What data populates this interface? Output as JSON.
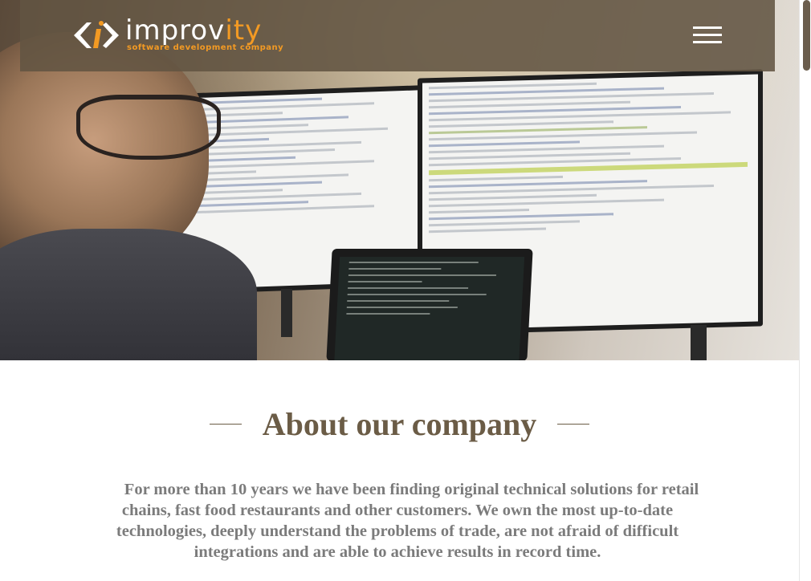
{
  "header": {
    "logo": {
      "name_main": "improv",
      "name_accent": "ity",
      "tagline": "software development company"
    },
    "menu_icon": "hamburger-menu-icon"
  },
  "hero": {
    "image": "developer-at-monitors-photo"
  },
  "about": {
    "title": "About our company",
    "text": "For more than 10 years we have been finding original technical solutions for retail chains, fast food restaurants and other customers. We own the most up-to-date technologies, deeply understand the problems of trade, are not afraid of difficult integrations and are able to achieve results in record time."
  },
  "colors": {
    "brand_brown": "#6b5c46",
    "brand_orange": "#f39a23",
    "header_bg": "#625442",
    "body_text": "#7b7b7b"
  }
}
